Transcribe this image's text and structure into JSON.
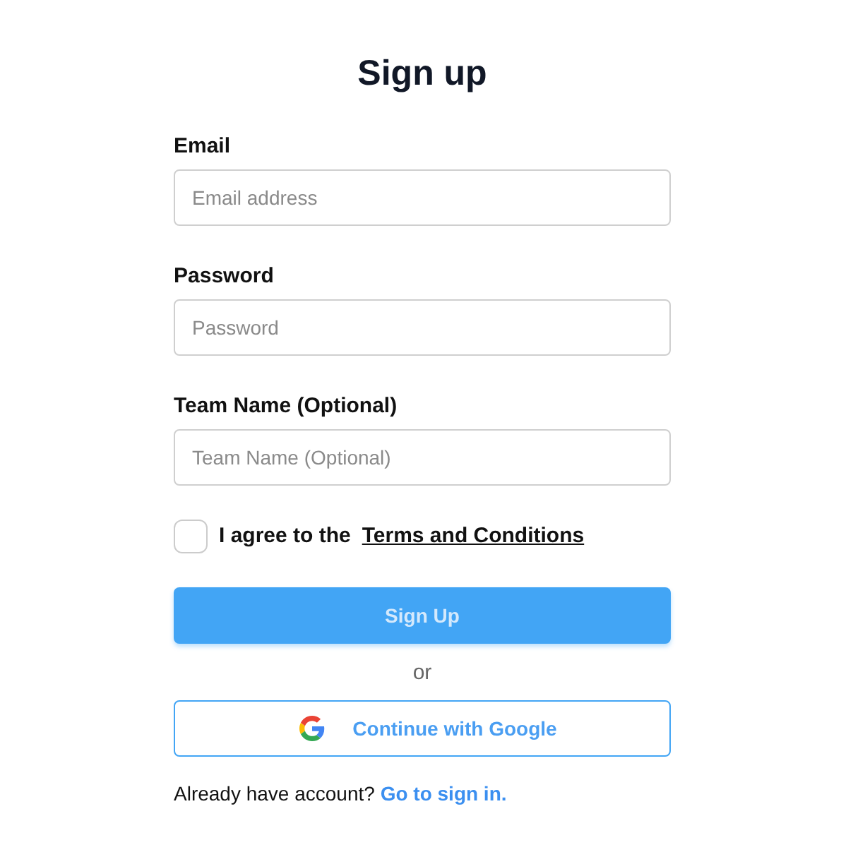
{
  "title": "Sign up",
  "fields": [
    {
      "label": "Email",
      "placeholder": "Email address"
    },
    {
      "label": "Password",
      "placeholder": "Password"
    },
    {
      "label": "Team Name (Optional)",
      "placeholder": "Team Name (Optional)"
    }
  ],
  "agreement": {
    "checked": false,
    "text": "I agree to the",
    "link": "Terms and Conditions"
  },
  "submit": {
    "label": "Sign Up",
    "disabled": true
  },
  "divider": "or",
  "google_button": {
    "label": "Continue with Google"
  },
  "footer": {
    "text": "Already have account?",
    "link": "Go to sign in."
  }
}
